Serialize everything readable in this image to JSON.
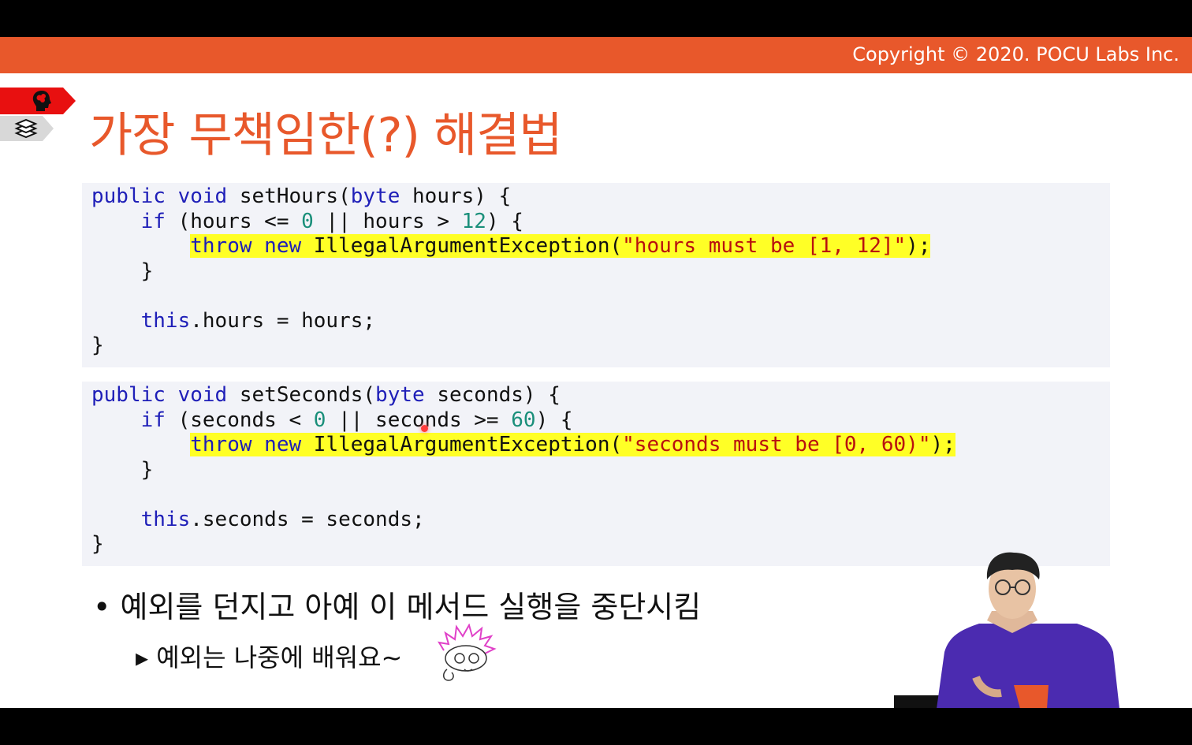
{
  "header": {
    "copyright": "Copyright © 2020. POCU Labs Inc."
  },
  "tags": [
    {
      "icon": "brain-head-icon"
    },
    {
      "icon": "books-stack-icon"
    }
  ],
  "slide": {
    "title": "가장 무책임한(?) 해결법"
  },
  "code_blocks": [
    {
      "lines": {
        "l1": {
          "a": "public",
          "b": " ",
          "c": "void",
          "d": " setHours(",
          "e": "byte",
          "f": " hours) {"
        },
        "l2": {
          "a": "    ",
          "b": "if",
          "c": " (hours <= ",
          "d": "0",
          "e": " || hours > ",
          "f": "12",
          "g": ") {"
        },
        "l3": {
          "indent": "        ",
          "a": "throw",
          "b": " ",
          "c": "new",
          "d": " IllegalArgumentException(",
          "e": "\"hours must be [1, 12]\"",
          "f": ");"
        },
        "l4": "    }",
        "l5": "",
        "l6": {
          "a": "    ",
          "b": "this",
          "c": ".hours = hours;"
        },
        "l7": "}"
      }
    },
    {
      "lines": {
        "l1": {
          "a": "public",
          "b": " ",
          "c": "void",
          "d": " setSeconds(",
          "e": "byte",
          "f": " seconds) {"
        },
        "l2": {
          "a": "    ",
          "b": "if",
          "c": " (seconds < ",
          "d": "0",
          "e": " || seconds >= ",
          "f": "60",
          "g": ") {"
        },
        "l3": {
          "indent": "        ",
          "a": "throw",
          "b": " ",
          "c": "new",
          "d": " IllegalArgumentException(",
          "e": "\"seconds must be [0, 60)\"",
          "f": ");"
        },
        "l4": "    }",
        "l5": "",
        "l6": {
          "a": "    ",
          "b": "this",
          "c": ".seconds = seconds;"
        },
        "l7": "}"
      }
    }
  ],
  "bullets": {
    "main": "• 예외를 던지고 아예 이 메서드 실행을 중단시킴",
    "sub": "▸ 예외는 나중에 배워요~"
  },
  "colors": {
    "accent": "#e8582b",
    "keyword": "#1f1fb8",
    "number": "#1a8f7a",
    "string": "#b8100f",
    "highlight": "#ffff26",
    "code_bg": "#f2f3f8"
  }
}
